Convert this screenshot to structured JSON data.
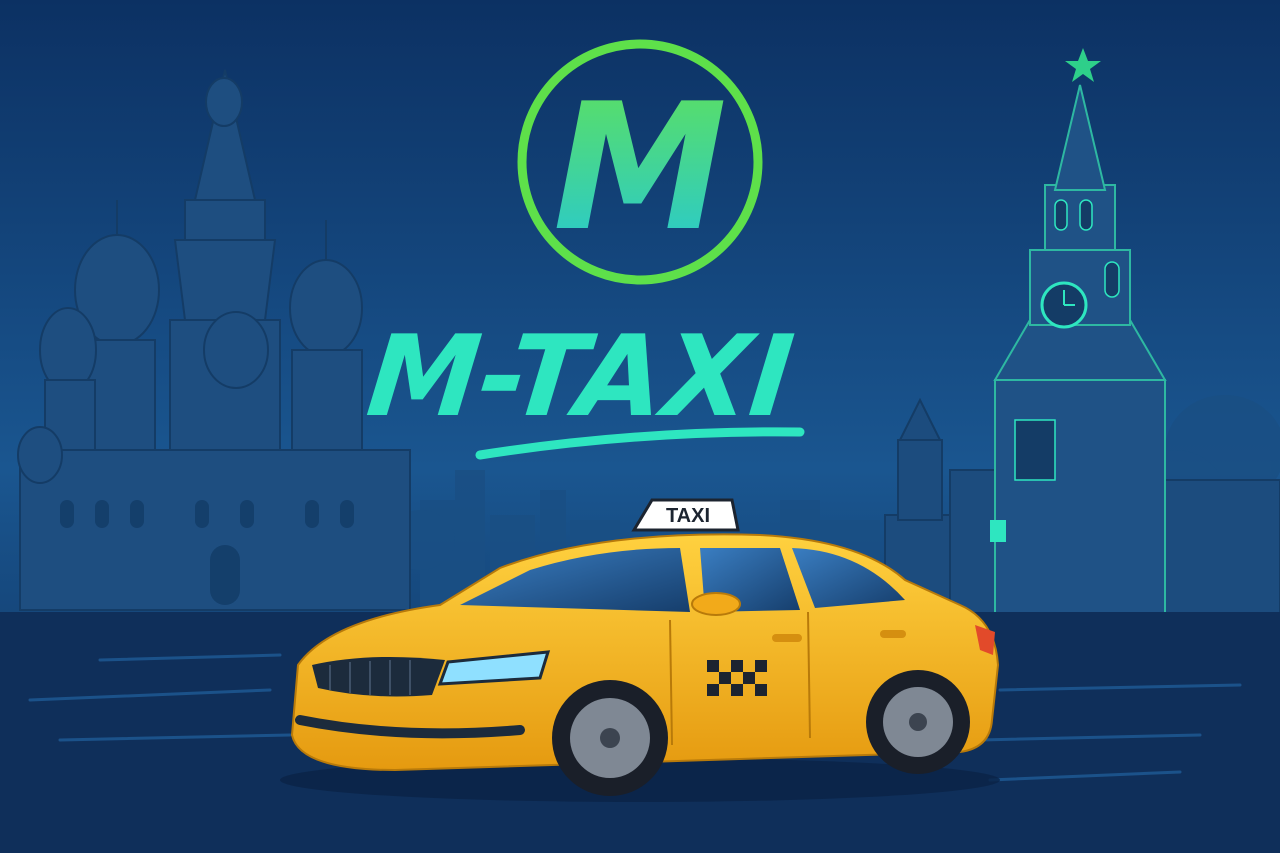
{
  "brand": {
    "logo_letter": "M",
    "name": "M-TAXI",
    "roof_sign": "TAXI"
  },
  "colors": {
    "sky": "#0d3566",
    "sky_light": "#1d5b93",
    "skyline": "#1a4a7c",
    "skyline_dark": "#123c68",
    "accent_green": "#5ee04a",
    "accent_teal": "#2ee6c0",
    "car_yellow": "#f7b924",
    "road": "#0f2f5a"
  },
  "icons": {
    "logo": "metro-m-circle-icon",
    "star": "kremlin-star-icon",
    "car": "taxi-car-icon",
    "checker": "taxi-checker-icon"
  }
}
